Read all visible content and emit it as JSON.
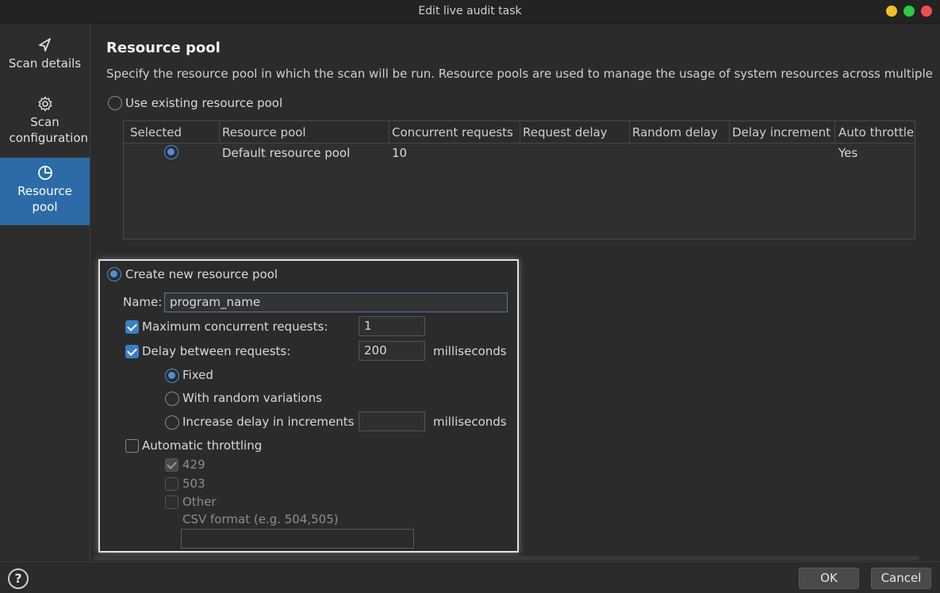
{
  "window": {
    "title": "Edit live audit task",
    "controls": [
      {
        "name": "minimize",
        "color": "#f6bd2b"
      },
      {
        "name": "maximize",
        "color": "#2fc840"
      },
      {
        "name": "close",
        "color": "#ef4f4f"
      }
    ]
  },
  "sidebar": {
    "items": [
      {
        "label": "Scan details",
        "icon": "paper-plane-icon",
        "active": false
      },
      {
        "label": "Scan configuration",
        "icon": "gear-icon",
        "active": false
      },
      {
        "label": "Resource pool",
        "icon": "pie-chart-icon",
        "active": true
      }
    ]
  },
  "page": {
    "title": "Resource pool",
    "description": "Specify the resource pool in which the scan will be run. Resource pools are used to manage the usage of system resources across multiple tasks."
  },
  "existing_pool": {
    "label": "Use existing resource pool",
    "selected": false,
    "table": {
      "columns": [
        "Selected",
        "Resource pool",
        "Concurrent requests",
        "Request delay",
        "Random delay",
        "Delay increment",
        "Auto throttle"
      ],
      "rows": [
        {
          "selected": true,
          "resource_pool": "Default resource pool",
          "concurrent_requests": "10",
          "request_delay": "",
          "random_delay": "",
          "delay_increment": "",
          "auto_throttle": "Yes"
        }
      ]
    }
  },
  "new_pool": {
    "label": "Create new resource pool",
    "selected": true,
    "name_label": "Name:",
    "name_value": "program_name",
    "max_concurrent": {
      "label": "Maximum concurrent requests:",
      "checked": true,
      "value": "1"
    },
    "delay": {
      "label": "Delay between requests:",
      "checked": true,
      "value": "200",
      "unit": "milliseconds"
    },
    "delay_modes": {
      "fixed": {
        "label": "Fixed",
        "selected": true
      },
      "random": {
        "label": "With random variations",
        "selected": false
      },
      "increment": {
        "label": "Increase delay in increments of",
        "selected": false,
        "value": "",
        "unit": "milliseconds"
      }
    },
    "throttling": {
      "label": "Automatic throttling",
      "checked": false,
      "codes": [
        {
          "label": "429",
          "checked": true
        },
        {
          "label": "503",
          "checked": false
        },
        {
          "label": "Other",
          "checked": false
        }
      ],
      "csv_label": "CSV format (e.g. 504,505)",
      "csv_value": ""
    }
  },
  "footer": {
    "help": "?",
    "ok": "OK",
    "cancel": "Cancel"
  },
  "colors": {
    "accent": "#2c6ba7",
    "radio_on": "#4b8fd6",
    "background": "#2b2b2b"
  }
}
